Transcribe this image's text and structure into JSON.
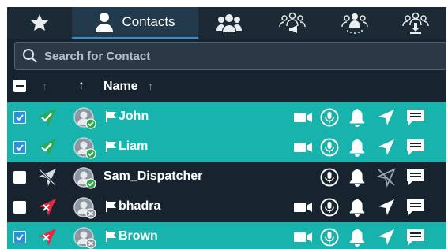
{
  "tabs": [
    {
      "icon": "star-icon"
    },
    {
      "icon": "contact-person-icon",
      "label": "Contacts",
      "active": true
    },
    {
      "icon": "group-icon"
    },
    {
      "icon": "group-broadcast-icon"
    },
    {
      "icon": "group-dispatch-icon"
    },
    {
      "icon": "group-download-icon"
    }
  ],
  "search": {
    "placeholder": "Search for Contact"
  },
  "header": {
    "name_label": "Name"
  },
  "colors": {
    "selected_row": "#17b3ac",
    "panel_bg": "#17232f",
    "online_status": "#2ea84a",
    "offline_status": "#e8283a"
  },
  "rows": [
    {
      "checked": true,
      "name": "John",
      "status": "online",
      "avatar_badge": "online",
      "flag": true,
      "video": true,
      "location": true,
      "selected": true
    },
    {
      "checked": true,
      "name": "Liam",
      "status": "online",
      "avatar_badge": "online",
      "flag": true,
      "video": true,
      "location": true,
      "selected": true
    },
    {
      "checked": false,
      "name": "Sam_Dispatcher",
      "status": "disabled",
      "avatar_badge": "online",
      "flag": false,
      "video": false,
      "location": false,
      "selected": false
    },
    {
      "checked": false,
      "name": "bhadra",
      "status": "offline",
      "avatar_badge": "offline",
      "flag": true,
      "video": true,
      "location": true,
      "selected": false
    },
    {
      "checked": true,
      "name": "Brown",
      "status": "offline",
      "avatar_badge": "offline",
      "flag": true,
      "video": true,
      "location": true,
      "selected": true
    }
  ]
}
